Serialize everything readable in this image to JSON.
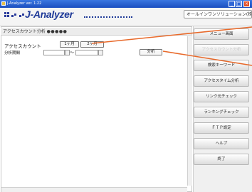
{
  "window": {
    "title": "J-Analyzer  ver. 1.22"
  },
  "header": {
    "logo_text": "J-Analyzer",
    "vendor_label": "オールインワンソリューション(株)"
  },
  "panel": {
    "title": "アクセスカウント分析",
    "title_dots": "●●●●●",
    "access_count_label": "アクセスカウント",
    "period_label": "分析期間",
    "btn_1month": "1ヶ月",
    "btn_2month": "2ヶ月",
    "range_separator": "～",
    "analyze_btn": "分析"
  },
  "sidebar": {
    "items": [
      {
        "label": "メニュー画面",
        "enabled": true
      },
      {
        "label": "アクセスカウント分析",
        "enabled": false
      },
      {
        "label": "検索キーワード",
        "enabled": true
      },
      {
        "label": "アクセスタイム分析",
        "enabled": true
      },
      {
        "label": "リンク元チェック",
        "enabled": true
      },
      {
        "label": "ランキングチェック",
        "enabled": true
      },
      {
        "label": "ＦＴＰ設定",
        "enabled": true
      },
      {
        "label": "ヘルプ",
        "enabled": true
      },
      {
        "label": "終了",
        "enabled": true
      }
    ]
  },
  "colors": {
    "callout": "#e8692a",
    "logo": "#1f3a98",
    "titlebar": "#2a5fd0"
  }
}
